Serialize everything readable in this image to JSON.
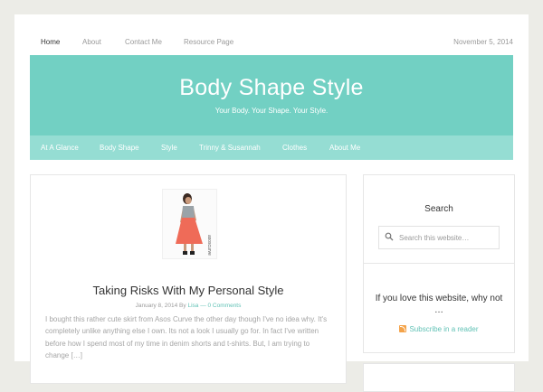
{
  "top_nav": {
    "items": [
      "Home",
      "About",
      "Contact Me",
      "Resource Page"
    ],
    "active": "Home",
    "date": "November 5, 2014"
  },
  "header": {
    "title": "Body Shape Style",
    "tagline": "Your Body. Your Shape. Your Style.",
    "bg_color": "#72d0c3"
  },
  "primary_nav": {
    "items": [
      "At A Glance",
      "Body Shape",
      "Style",
      "Trinny & Susannah",
      "Clothes",
      "About Me"
    ],
    "bg_color": "#95ddd3"
  },
  "post": {
    "title": "Taking Risks With My Personal Style",
    "date": "January 8, 2014",
    "by": "By",
    "author": "Lisa",
    "separator": "—",
    "comments": "0 Comments",
    "excerpt": "I bought this rather cute skirt from Asos Curve the other day though I've no idea why. It's completely unlike anything else I own. Its not a look I usually go for. In fact I've written before how I spend most of my time in denim shorts and t-shirts. But, I am trying to change […]",
    "image_label": "asoscurve"
  },
  "sidebar": {
    "search": {
      "title": "Search",
      "placeholder": "Search this website…",
      "icon": "search-icon"
    },
    "subscribe": {
      "title": "If you love this website, why not …",
      "link": "Subscribe in a reader",
      "icon": "rss-icon"
    }
  },
  "colors": {
    "accent": "#62c2b6",
    "page_bg": "#ecece7"
  }
}
